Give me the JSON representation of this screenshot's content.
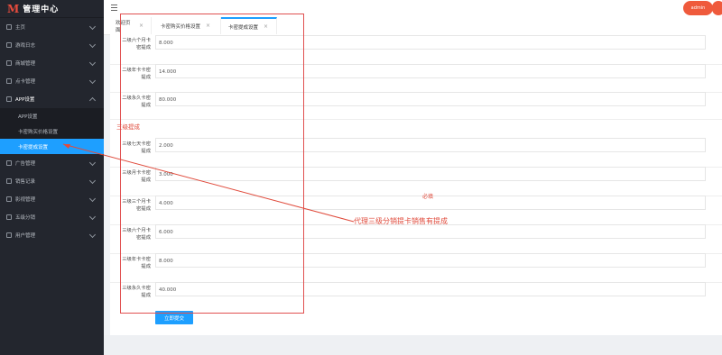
{
  "app": {
    "logo_mark": "M",
    "title": "管理中心"
  },
  "sidebar": {
    "items": [
      {
        "label": "主页"
      },
      {
        "label": "游戏日志"
      },
      {
        "label": "商城管理"
      },
      {
        "label": "点卡管理"
      },
      {
        "label": "APP设置",
        "open": true
      },
      {
        "label": "广告管理"
      },
      {
        "label": "销售记录"
      },
      {
        "label": "影视管理"
      },
      {
        "label": "五级分销"
      },
      {
        "label": "用户管理"
      }
    ],
    "submenu": [
      {
        "label": "APP设置"
      },
      {
        "label": "卡密购买价格设置"
      },
      {
        "label": "卡密提成设置",
        "active": true
      }
    ]
  },
  "header": {
    "user_label": "admin"
  },
  "tabs": [
    {
      "label": "欢迎页面"
    },
    {
      "label": "卡密购买价格设置"
    },
    {
      "label": "卡密提成设置",
      "active": true
    }
  ],
  "form": {
    "rows_top": [
      {
        "label": "二级六个月卡密提成",
        "value": "8.000"
      },
      {
        "label": "二级年卡卡密提成",
        "value": "14.000"
      },
      {
        "label": "二级永久卡密提成",
        "value": "80.000"
      }
    ],
    "section_title": "三级提成",
    "rows_bottom": [
      {
        "label": "三级七天卡密提成",
        "value": "2.000"
      },
      {
        "label": "三级月卡卡密提成",
        "value": "3.000"
      },
      {
        "label": "三级三个月卡密提成",
        "value": "4.000"
      },
      {
        "label": "三级六个月卡密提成",
        "value": "6.000"
      },
      {
        "label": "三级年卡卡密提成",
        "value": "8.000"
      },
      {
        "label": "三级永久卡密提成",
        "value": "40.000"
      }
    ],
    "submit_label": "立即提交"
  },
  "annotation": {
    "note": "代理三级分销提卡销售有提成",
    "must": "必填"
  },
  "colors": {
    "accent": "#1e9fff",
    "sidebar_bg": "#23262e",
    "annotation": "#e04b3c"
  }
}
